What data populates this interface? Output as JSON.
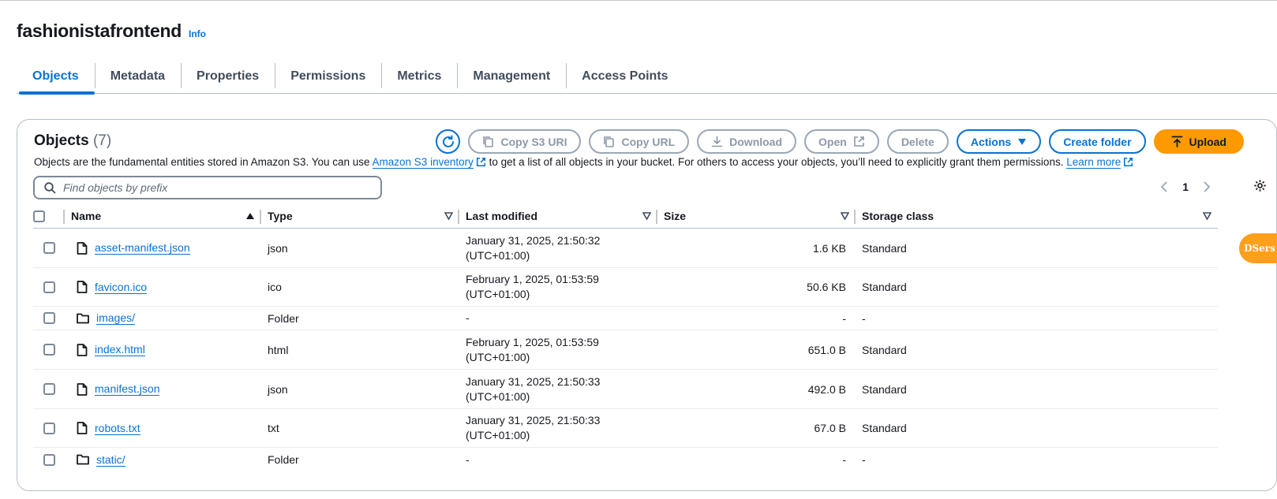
{
  "bucket": {
    "name": "fashionistafrontend",
    "info_label": "Info"
  },
  "tabs": [
    {
      "label": "Objects",
      "active": true
    },
    {
      "label": "Metadata"
    },
    {
      "label": "Properties"
    },
    {
      "label": "Permissions"
    },
    {
      "label": "Metrics"
    },
    {
      "label": "Management"
    },
    {
      "label": "Access Points"
    }
  ],
  "objects_panel": {
    "heading": "Objects",
    "count": "(7)",
    "buttons": {
      "refresh_icon": "refresh-icon",
      "copy_s3_uri": "Copy S3 URI",
      "copy_url": "Copy URL",
      "download": "Download",
      "open": "Open",
      "delete": "Delete",
      "actions": "Actions",
      "create_folder": "Create folder",
      "upload": "Upload"
    },
    "description": {
      "part1": "Objects are the fundamental entities stored in Amazon S3. You can use ",
      "link1": "Amazon S3 inventory",
      "part2": " to get a list of all objects in your bucket. For others to access your objects, you’ll need to explicitly grant them permissions. ",
      "link2": "Learn more"
    },
    "search": {
      "placeholder": "Find objects by prefix",
      "value": ""
    },
    "pagination": {
      "current_page": "1"
    }
  },
  "table": {
    "columns": [
      "Name",
      "Type",
      "Last modified",
      "Size",
      "Storage class"
    ],
    "rows": [
      {
        "icon": "file-icon",
        "name": "asset-manifest.json",
        "type": "json",
        "modified_line1": "January 31, 2025, 21:50:32",
        "modified_line2": "(UTC+01:00)",
        "size": "1.6 KB",
        "storage": "Standard"
      },
      {
        "icon": "file-icon",
        "name": "favicon.ico",
        "type": "ico",
        "modified_line1": "February 1, 2025, 01:53:59",
        "modified_line2": "(UTC+01:00)",
        "size": "50.6 KB",
        "storage": "Standard"
      },
      {
        "icon": "folder-icon",
        "name": "images/",
        "type": "Folder",
        "modified_line1": "-",
        "modified_line2": "",
        "size": "-",
        "storage": "-"
      },
      {
        "icon": "file-icon",
        "name": "index.html",
        "type": "html",
        "modified_line1": "February 1, 2025, 01:53:59",
        "modified_line2": "(UTC+01:00)",
        "size": "651.0 B",
        "storage": "Standard"
      },
      {
        "icon": "file-icon",
        "name": "manifest.json",
        "type": "json",
        "modified_line1": "January 31, 2025, 21:50:33",
        "modified_line2": "(UTC+01:00)",
        "size": "492.0 B",
        "storage": "Standard"
      },
      {
        "icon": "file-icon",
        "name": "robots.txt",
        "type": "txt",
        "modified_line1": "January 31, 2025, 21:50:33",
        "modified_line2": "(UTC+01:00)",
        "size": "67.0 B",
        "storage": "Standard"
      },
      {
        "icon": "folder-icon",
        "name": "static/",
        "type": "Folder",
        "modified_line1": "-",
        "modified_line2": "",
        "size": "-",
        "storage": "-"
      }
    ]
  },
  "extension": {
    "label": "DSers"
  },
  "colors": {
    "accent": "#0972d3",
    "upload": "#ff9900",
    "extension": "#ff9f1c",
    "text": "#16191f"
  }
}
